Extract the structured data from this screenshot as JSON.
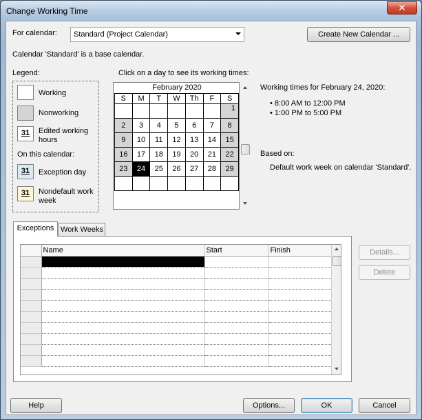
{
  "window": {
    "title": "Change Working Time",
    "close_glyph": "✕"
  },
  "calendar_select": {
    "label": "For calendar:",
    "value": "Standard (Project Calendar)",
    "create_button": "Create New Calendar ..."
  },
  "base_note": "Calendar 'Standard' is a base calendar.",
  "legend": {
    "title": "Legend:",
    "working": "Working",
    "nonworking": "Nonworking",
    "edited_line1": "Edited working",
    "edited_line2": "hours",
    "on_this_calendar": "On this calendar:",
    "exception": "Exception day",
    "nondefault_line1": "Nondefault work",
    "nondefault_line2": "week",
    "sample_num": "31"
  },
  "calendar": {
    "prompt": "Click on a day to see its working times:",
    "month": "February 2020",
    "weekdays": [
      "S",
      "M",
      "T",
      "W",
      "Th",
      "F",
      "S"
    ],
    "weeks": [
      [
        "",
        "",
        "",
        "",
        "",
        "",
        "1"
      ],
      [
        "2",
        "3",
        "4",
        "5",
        "6",
        "7",
        "8"
      ],
      [
        "9",
        "10",
        "11",
        "12",
        "13",
        "14",
        "15"
      ],
      [
        "16",
        "17",
        "18",
        "19",
        "20",
        "21",
        "22"
      ],
      [
        "23",
        "24",
        "25",
        "26",
        "27",
        "28",
        "29"
      ],
      [
        "",
        "",
        "",
        "",
        "",
        "",
        ""
      ]
    ],
    "selected_day": "24"
  },
  "working_times": {
    "heading": "Working times for February 24, 2020:",
    "times": [
      "8:00 AM to 12:00 PM",
      "1:00 PM to 5:00 PM"
    ],
    "based_on_label": "Based on:",
    "based_on_text": "Default work week on calendar 'Standard'."
  },
  "tabs": [
    {
      "label": "Exceptions",
      "active": true
    },
    {
      "label": "Work Weeks",
      "active": false
    }
  ],
  "exceptions_table": {
    "columns": [
      "Name",
      "Start",
      "Finish"
    ],
    "empty_rows": 10
  },
  "side_buttons": {
    "details": "Details...",
    "delete": "Delete"
  },
  "footer": {
    "help": "Help",
    "options": "Options...",
    "ok": "OK",
    "cancel": "Cancel"
  }
}
